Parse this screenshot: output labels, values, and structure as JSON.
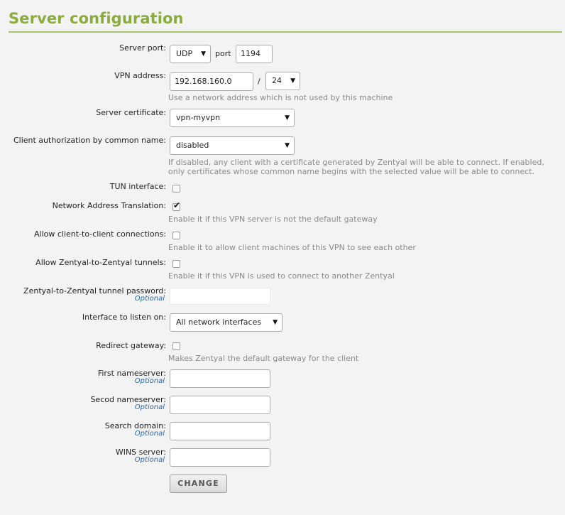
{
  "header": {
    "title": "Server configuration"
  },
  "form": {
    "server_port": {
      "label": "Server port:",
      "protocol": "UDP",
      "port_label": "port",
      "port": "1194"
    },
    "vpn_address": {
      "label": "VPN address:",
      "address": "192.168.160.0",
      "separator": "/",
      "netmask": "24",
      "help": "Use a network address which is not used by this machine"
    },
    "server_certificate": {
      "label": "Server certificate:",
      "value": "vpn-myvpn"
    },
    "client_auth": {
      "label": "Client authorization by common name:",
      "value": "disabled",
      "help_line1": "If disabled, any client with a certificate generated by Zentyal will be able to connect. If enabled,",
      "help_line2": "only certificates whose common name begins with the selected value will be able to connect."
    },
    "tun_interface": {
      "label": "TUN interface:",
      "checked": false
    },
    "nat": {
      "label": "Network Address Translation:",
      "checked": true,
      "check_glyph": "✔",
      "help": "Enable it if this VPN server is not the default gateway"
    },
    "client_to_client": {
      "label": "Allow client-to-client connections:",
      "checked": false,
      "help": "Enable it to allow client machines of this VPN to see each other"
    },
    "zentyal_tunnels": {
      "label": "Allow Zentyal-to-Zentyal tunnels:",
      "checked": false,
      "help": "Enable it if this VPN is used to connect to another Zentyal"
    },
    "tunnel_password": {
      "label": "Zentyal-to-Zentyal tunnel password:",
      "optional": "Optional",
      "value": ""
    },
    "listen_interface": {
      "label": "Interface to listen on:",
      "value": "All network interfaces"
    },
    "redirect_gateway": {
      "label": "Redirect gateway:",
      "checked": false,
      "help": "Makes Zentyal the default gateway for the client"
    },
    "first_nameserver": {
      "label": "First nameserver:",
      "optional": "Optional",
      "value": ""
    },
    "second_nameserver": {
      "label": "Secod nameserver:",
      "optional": "Optional",
      "value": ""
    },
    "search_domain": {
      "label": "Search domain:",
      "optional": "Optional",
      "value": ""
    },
    "wins_server": {
      "label": "WINS server:",
      "optional": "Optional",
      "value": ""
    },
    "submit_label": "CHANGE"
  },
  "icons": {
    "dropdown": "▼"
  },
  "colors": {
    "title": "#8cab3f",
    "rule": "#a8c46a",
    "optional": "#2968a3",
    "help": "#8a8a8a",
    "background": "#f3f3f3"
  }
}
